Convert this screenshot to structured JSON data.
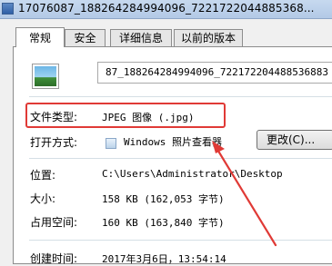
{
  "window": {
    "title": "17076087_188264284994096_7221722044885368..."
  },
  "tabs": [
    {
      "label": "常规",
      "active": true
    },
    {
      "label": "安全",
      "active": false
    },
    {
      "label": "详细信息",
      "active": false
    },
    {
      "label": "以前的版本",
      "active": false
    }
  ],
  "general": {
    "file_name": "87_188264284994096_722172204488536883",
    "file_type_label": "文件类型:",
    "file_type_value": "JPEG 图像 (.jpg)",
    "opens_with_label": "打开方式:",
    "opens_with_value": "Windows 照片查看器",
    "change_button": "更改(C)...",
    "location_label": "位置:",
    "location_value": "C:\\Users\\Administrator\\Desktop",
    "size_label": "大小:",
    "size_value": "158 KB (162,053 字节)",
    "size_on_disk_label": "占用空间:",
    "size_on_disk_value": "160 KB (163,840 字节)",
    "created_label": "创建时间:",
    "created_value": "2017年3月6日，13:54:14"
  },
  "annotation": {
    "highlight_color": "#e03a36",
    "icon": "red-arrow-icon"
  }
}
